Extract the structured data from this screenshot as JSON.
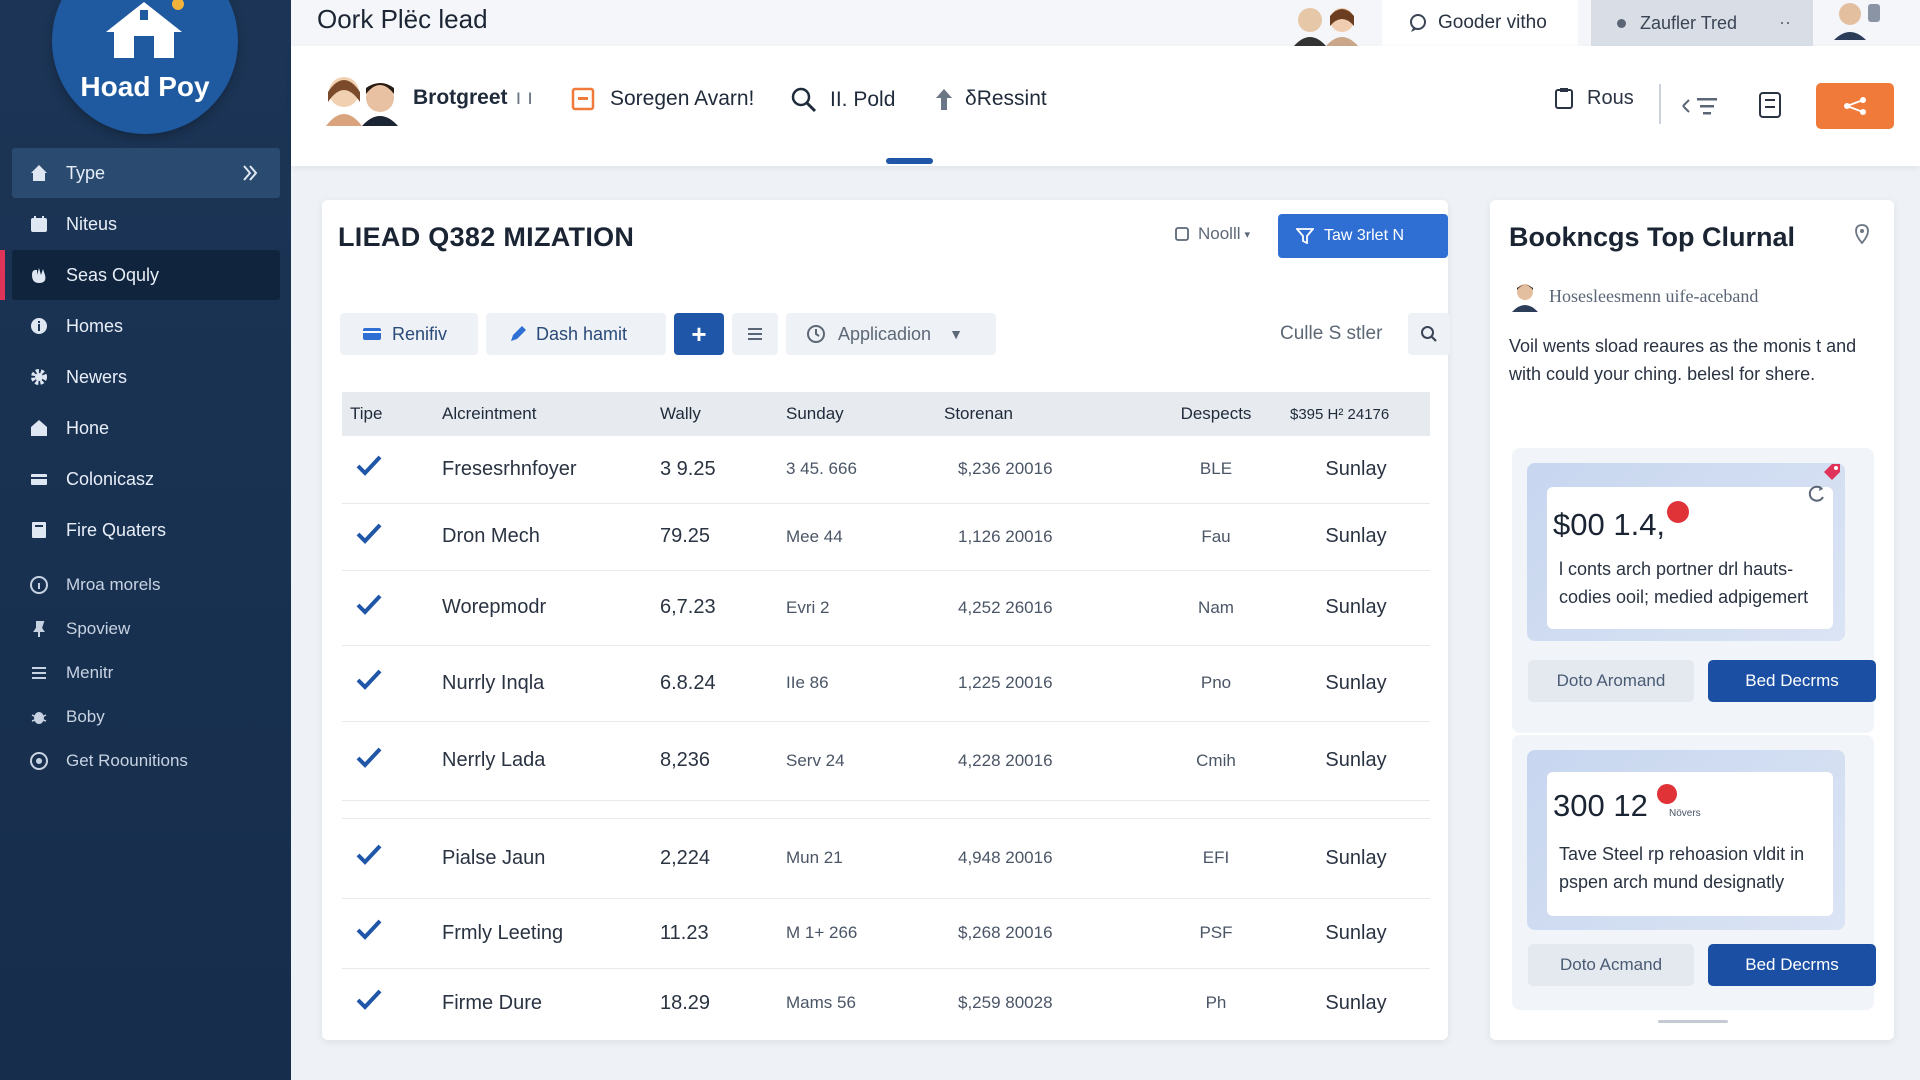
{
  "app": {
    "logo_text": "Hoad Poy",
    "title": "Oork Plëc lead"
  },
  "sidebar": {
    "items": [
      {
        "label": "Type",
        "icon": "home-icon"
      },
      {
        "label": "Niteus",
        "icon": "calendar-icon"
      },
      {
        "label": "Seas Oquly",
        "icon": "hand-icon"
      },
      {
        "label": "Homes",
        "icon": "info-icon"
      },
      {
        "label": "Newers",
        "icon": "gear-icon"
      },
      {
        "label": "Hone",
        "icon": "house-icon"
      },
      {
        "label": "Colonicasz",
        "icon": "card-icon"
      },
      {
        "label": "Fire Quaters",
        "icon": "book-icon"
      }
    ],
    "secondary": [
      {
        "label": "Mroa morels",
        "icon": "info-circle-icon"
      },
      {
        "label": "Spoview",
        "icon": "pin-icon"
      },
      {
        "label": "Menitr",
        "icon": "menu-icon"
      },
      {
        "label": "Boby",
        "icon": "bug-icon"
      },
      {
        "label": "Get Roounitions",
        "icon": "help-icon"
      }
    ]
  },
  "topbar": {
    "tab1": "Gooder vitho",
    "tab2": "Zaufler Tred",
    "tab2_more": "··"
  },
  "toolbar": {
    "user_name": "Brotgreet",
    "user_suffix": "ı ı",
    "nav": [
      "Soregen Avarn!",
      "II. Pold",
      "δRessint"
    ],
    "right_label": "Rous"
  },
  "panel": {
    "title": "LIEAD Q382 MIZATION",
    "sub_label": "Noolll",
    "primary_label": "Taw 3rlet N",
    "filters": [
      "Renifiv",
      "Dash hamit",
      "+",
      "Applicadion"
    ],
    "search_text": "Culle S stler",
    "columns": [
      "Tipe",
      "Alcreintment",
      "Wally",
      "Sunday",
      "Storenan",
      "Despects",
      "$395 H² 24176"
    ],
    "rows": [
      {
        "name": "Fresesrhnfoyer",
        "wally": "3 9.25",
        "sunday": "3 45. 666",
        "storenan": "$,236 20016",
        "despects": "BLE",
        "last": "Sunlay"
      },
      {
        "name": "Dron Mech",
        "wally": "79.25",
        "sunday": "Mee 44",
        "storenan": "1,126 20016",
        "despects": "Fau",
        "last": "Sunlay"
      },
      {
        "name": "Worepmodr",
        "wally": "6,7.23",
        "sunday": "Evri 2",
        "storenan": "4,252 26016",
        "despects": "Nam",
        "last": "Sunlay"
      },
      {
        "name": "Nurrly Inqla",
        "wally": "6.8.24",
        "sunday": "IIe 86",
        "storenan": "1,225 20016",
        "despects": "Pno",
        "last": "Sunlay"
      },
      {
        "name": "Nerrly Lada",
        "wally": "8,236",
        "sunday": "Serv 24",
        "storenan": "4,228 20016",
        "despects": "Cmih",
        "last": "Sunlay"
      },
      {
        "name": "Pialse Jaun",
        "wally": "2,224",
        "sunday": "Mun 21",
        "storenan": "4,948 20016",
        "despects": "EFI",
        "last": "Sunlay"
      },
      {
        "name": "Frmly Leeting",
        "wally": "11.23",
        "sunday": "M 1+ 266",
        "storenan": "$,268 20016",
        "despects": "PSF",
        "last": "Sunlay"
      },
      {
        "name": "Firme Dure",
        "wally": "18.29",
        "sunday": "Mams 56",
        "storenan": "$,259 80028",
        "despects": "Ph",
        "last": "Sunlay"
      }
    ]
  },
  "right_panel": {
    "title": "Bookncgs Top Clurnal",
    "author": "Hosesleesmenn uife-aceband",
    "description": "Voil wents sload reaures as the monis t and with could your ching. belesl for shere.",
    "cards": [
      {
        "price": "$00 1.4,",
        "badge": "",
        "text": "l conts arch portner drl hauts-codies ooil; medied adpigemert",
        "secondary": "Doto Aromand",
        "primary": "Bed Decrms"
      },
      {
        "price": "300 12",
        "badge": "Növers",
        "text": "Tave Steel rp rehoasion vldit in pspen arch mund designatly",
        "secondary": "Doto Acmand",
        "primary": "Bed Decrms"
      }
    ]
  },
  "colors": {
    "sidebar": "#1c3556",
    "accent": "#1f56a8",
    "orange": "#f07a3a",
    "alert": "#e0335a"
  }
}
